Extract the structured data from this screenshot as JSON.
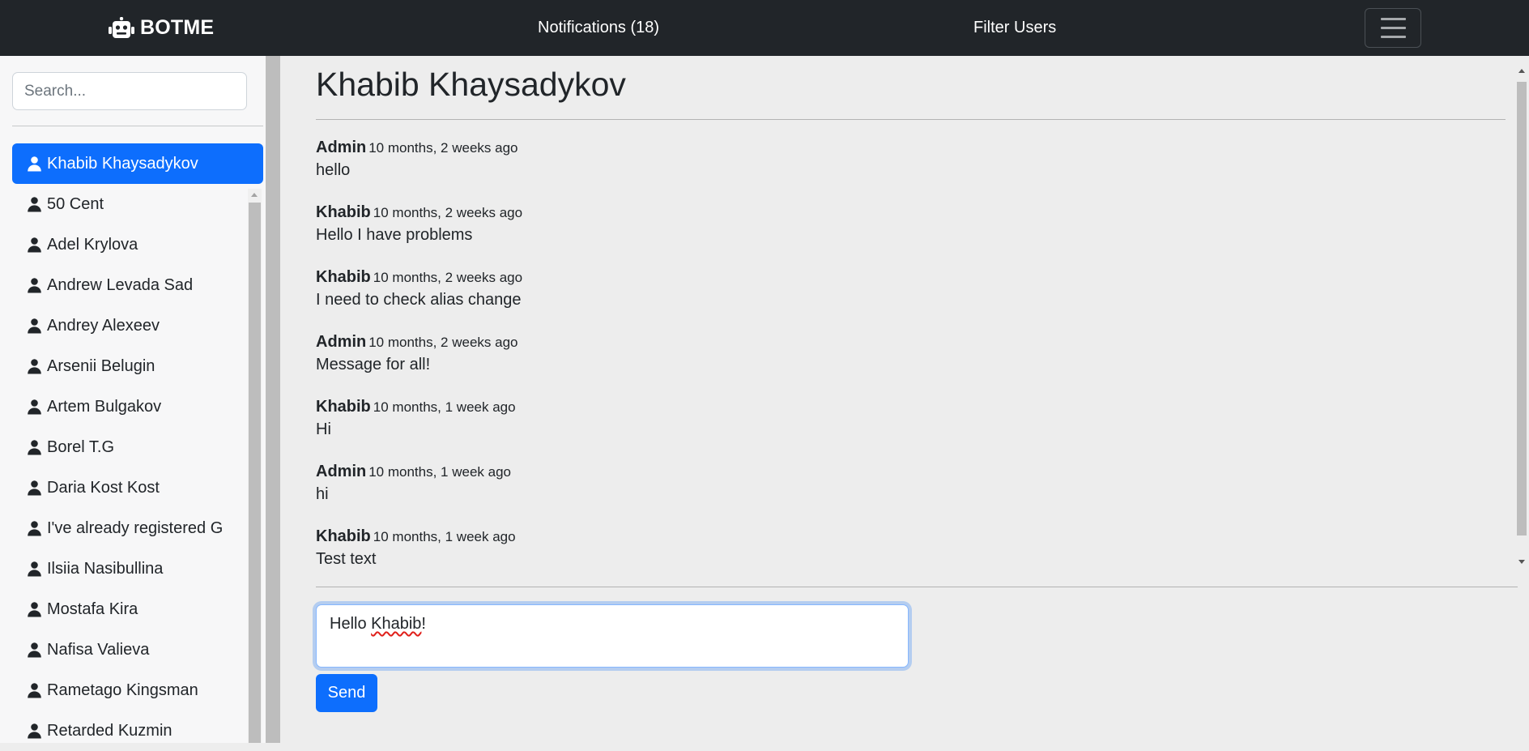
{
  "navbar": {
    "brand": "BOTME",
    "brand_icon": "robot-icon",
    "notifications": "Notifications (18)",
    "filter_users": "Filter Users",
    "menu_icon": "hamburger-menu-icon"
  },
  "sidebar": {
    "search_placeholder": "Search...",
    "users": [
      {
        "name": "Khabib Khaysadykov",
        "active": true
      },
      {
        "name": "50 Cent"
      },
      {
        "name": "Adel Krylova"
      },
      {
        "name": "Andrew Levada Sad"
      },
      {
        "name": "Andrey Alexeev"
      },
      {
        "name": "Arsenii Belugin"
      },
      {
        "name": "Artem Bulgakov"
      },
      {
        "name": "Borel T.G"
      },
      {
        "name": "Daria Kost Kost"
      },
      {
        "name": "I've already registered G"
      },
      {
        "name": "Ilsiia Nasibullina"
      },
      {
        "name": "Mostafa Kira"
      },
      {
        "name": "Nafisa Valieva"
      },
      {
        "name": "Rametago Kingsman"
      },
      {
        "name": "Retarded Kuzmin"
      }
    ]
  },
  "conversation": {
    "title": "Khabib Khaysadykov",
    "messages": [
      {
        "author": "Admin",
        "time": "10 months, 2 weeks ago",
        "text": "hello"
      },
      {
        "author": "Khabib",
        "time": "10 months, 2 weeks ago",
        "text": "Hello I have problems"
      },
      {
        "author": "Khabib",
        "time": "10 months, 2 weeks ago",
        "text": "I need to check alias change"
      },
      {
        "author": "Admin",
        "time": "10 months, 2 weeks ago",
        "text": "Message for all!"
      },
      {
        "author": "Khabib",
        "time": "10 months, 1 week ago",
        "text": "Hi"
      },
      {
        "author": "Admin",
        "time": "10 months, 1 week ago",
        "text": "hi"
      },
      {
        "author": "Khabib",
        "time": "10 months, 1 week ago",
        "text": "Test text"
      }
    ],
    "compose": {
      "greeting": "Hello ",
      "name": "Khabib",
      "punct": "!"
    },
    "send_label": "Send"
  },
  "colors": {
    "navbar": "#212529",
    "accent": "#0d6efd",
    "main_bg": "#ededed",
    "sidebar_bg": "#f7f7f8"
  }
}
